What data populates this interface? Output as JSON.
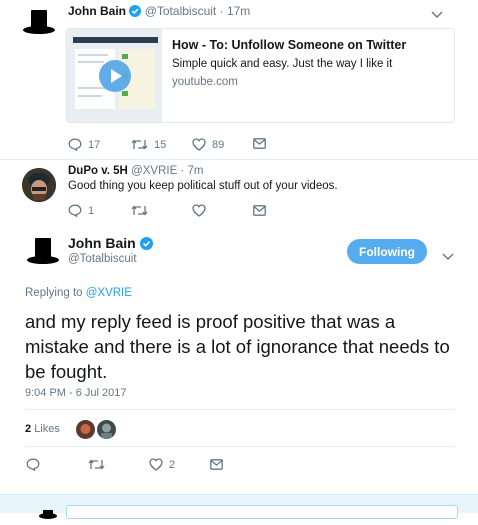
{
  "tweet1": {
    "name": "John Bain",
    "handle": "@Totalbiscuit",
    "time": "17m",
    "card": {
      "title": "How - To: Unfollow Someone on Twitter",
      "description": "Simple quick and easy. Just the way I like it",
      "domain": "youtube.com"
    },
    "replies": "17",
    "retweets": "15",
    "likes": "89"
  },
  "tweet2": {
    "name": "DuPo v. 5H",
    "handle": "@XVRIE",
    "time": "7m",
    "text": "Good thing you keep political stuff out of your videos.",
    "replies": "1"
  },
  "main": {
    "name": "John Bain",
    "handle": "@Totalbiscuit",
    "follow_label": "Following",
    "replying_prefix": "Replying to ",
    "replying_to": "@XVRIE",
    "text": "and my reply feed is proof positive that was a mistake and there is a lot of ignorance that needs to be fought.",
    "timestamp": "9:04 PM - 6 Jul 2017",
    "likes_count": "2",
    "likes_label": "Likes",
    "like_action_count": "2"
  },
  "colors": {
    "accent": "#1da1f2",
    "follow_button": "#55acee",
    "muted": "#657786",
    "border": "#e6ecf0"
  }
}
